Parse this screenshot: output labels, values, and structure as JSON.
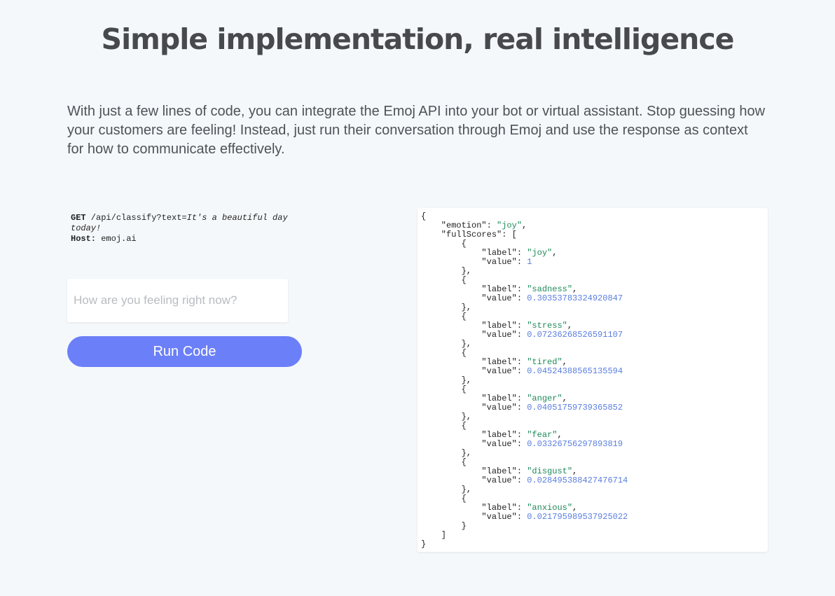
{
  "heading": "Simple implementation, real intelligence",
  "intro": "With just a few lines of code, you can integrate the Emoj API into your bot or virtual assistant. Stop guessing how your customers are feeling! Instead, just run their conversation through Emoj and use the response as context for how to communicate effectively.",
  "request": {
    "method": "GET",
    "path": " /api/classify?text=",
    "text": "It's a beautiful day today!",
    "host_label": "Host:",
    "host_value": " emoj.ai"
  },
  "input": {
    "placeholder": "How are you feeling right now?",
    "value": ""
  },
  "run_button": {
    "label": "Run Code"
  },
  "response": {
    "emotion_key": "\"emotion\"",
    "emotion": "joy",
    "full_scores_key": "\"fullScores\"",
    "label_key": "\"label\"",
    "value_key": "\"value\"",
    "scores": [
      {
        "label": "joy",
        "value": "1"
      },
      {
        "label": "sadness",
        "value": "0.30353783324920847"
      },
      {
        "label": "stress",
        "value": "0.07236268526591107"
      },
      {
        "label": "tired",
        "value": "0.04524388565135594"
      },
      {
        "label": "anger",
        "value": "0.04051759739365852"
      },
      {
        "label": "fear",
        "value": "0.03326756297893819"
      },
      {
        "label": "disgust",
        "value": "0.028495388427476714"
      },
      {
        "label": "anxious",
        "value": "0.021795989537925022"
      }
    ]
  },
  "colors": {
    "background": "#f5f8fb",
    "button": "#6b7ff8",
    "string": "#1f8a5a",
    "number": "#5a7ee0"
  }
}
